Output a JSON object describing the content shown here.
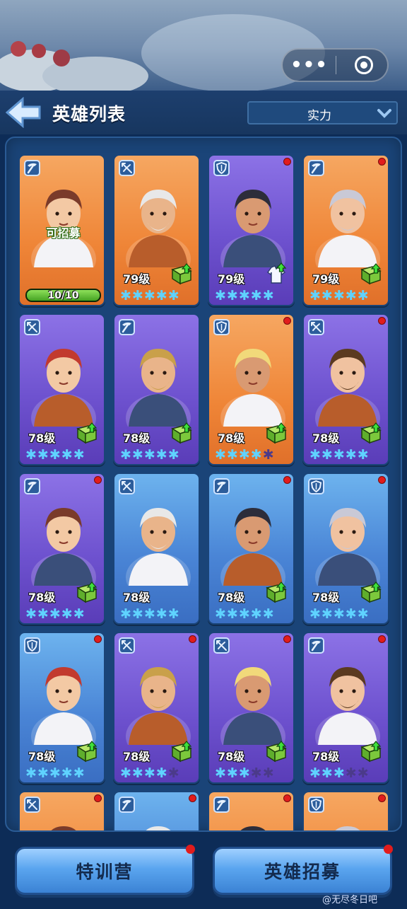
{
  "header": {
    "title": "英雄列表",
    "sort_value": "实力",
    "menu_dots": "•••"
  },
  "heroes": [
    {
      "role": "pickaxe",
      "bg": "orange",
      "level": "",
      "stars": 0,
      "upgrade": "none",
      "dot": false,
      "recruitable": true,
      "recruit_label": "可招募",
      "shards": "10/10",
      "shard_ratio": 1.0
    },
    {
      "role": "crossbow",
      "bg": "orange",
      "level": "79级",
      "stars": 5,
      "upgrade": "book",
      "dot": false
    },
    {
      "role": "shield",
      "bg": "purple",
      "level": "79级",
      "stars": 5,
      "upgrade": "coat",
      "dot": true
    },
    {
      "role": "pickaxe",
      "bg": "orange",
      "level": "79级",
      "stars": 5,
      "upgrade": "book",
      "dot": true
    },
    {
      "role": "crossbow",
      "bg": "purple",
      "level": "78级",
      "stars": 5,
      "upgrade": "book",
      "dot": false
    },
    {
      "role": "pickaxe",
      "bg": "purple",
      "level": "78级",
      "stars": 5,
      "upgrade": "book",
      "dot": false
    },
    {
      "role": "shield",
      "bg": "orange",
      "level": "78级",
      "stars": 4,
      "upgrade": "book",
      "dot": true
    },
    {
      "role": "crossbow",
      "bg": "purple",
      "level": "78级",
      "stars": 5,
      "upgrade": "book",
      "dot": true
    },
    {
      "role": "pickaxe",
      "bg": "purple",
      "level": "78级",
      "stars": 5,
      "upgrade": "book",
      "dot": true
    },
    {
      "role": "crossbow",
      "bg": "blue",
      "level": "78级",
      "stars": 5,
      "upgrade": "none",
      "dot": false
    },
    {
      "role": "pickaxe",
      "bg": "blue",
      "level": "78级",
      "stars": 5,
      "upgrade": "book",
      "dot": true
    },
    {
      "role": "shield",
      "bg": "blue",
      "level": "78级",
      "stars": 5,
      "upgrade": "book",
      "dot": true
    },
    {
      "role": "shield",
      "bg": "blue",
      "level": "78级",
      "stars": 5,
      "upgrade": "book",
      "dot": true
    },
    {
      "role": "crossbow",
      "bg": "purple",
      "level": "78级",
      "stars": 4,
      "upgrade": "book",
      "dot": true
    },
    {
      "role": "crossbow",
      "bg": "purple",
      "level": "78级",
      "stars": 3,
      "upgrade": "book",
      "dot": true
    },
    {
      "role": "pickaxe",
      "bg": "purple",
      "level": "78级",
      "stars": 3,
      "upgrade": "book",
      "dot": true
    },
    {
      "role": "crossbow",
      "bg": "orange",
      "level": "",
      "stars": -1,
      "upgrade": "none",
      "dot": true
    },
    {
      "role": "pickaxe",
      "bg": "blue",
      "level": "",
      "stars": -1,
      "upgrade": "none",
      "dot": true
    },
    {
      "role": "pickaxe",
      "bg": "orange",
      "level": "",
      "stars": -1,
      "upgrade": "none",
      "dot": true
    },
    {
      "role": "shield",
      "bg": "orange",
      "level": "",
      "stars": -1,
      "upgrade": "none",
      "dot": true
    }
  ],
  "buttons": {
    "training": "特训营",
    "recruit": "英雄招募"
  },
  "watermark": "@无尽冬日吧",
  "colors": {
    "star_active": "#5fd3ff",
    "star_inactive": "#4b3a8a",
    "red_dot": "#e11c1c",
    "panel": "#1a4478"
  }
}
